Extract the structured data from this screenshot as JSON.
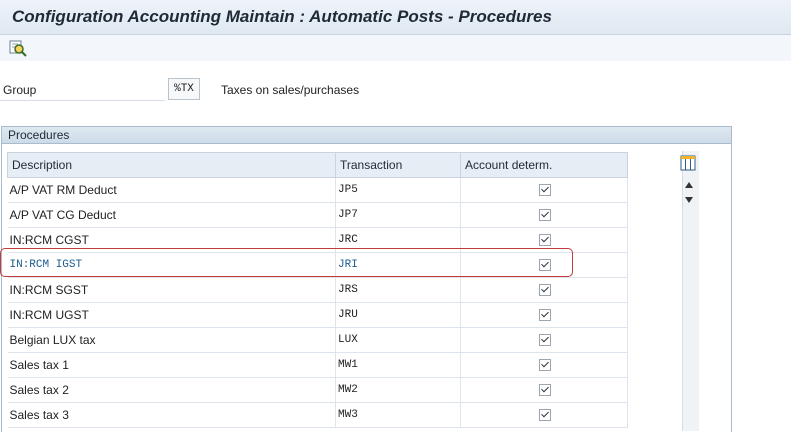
{
  "title": "Configuration Accounting Maintain : Automatic Posts - Procedures",
  "toolbar": {
    "icon": "find-icon"
  },
  "group": {
    "label": "Group",
    "value": "%TX",
    "description": "Taxes on sales/purchases"
  },
  "procedures": {
    "title": "Procedures",
    "columns": [
      "Description",
      "Transaction",
      "Account determ."
    ],
    "rows": [
      {
        "description": "A/P VAT RM Deduct",
        "transaction": "JP5",
        "account_determ": true
      },
      {
        "description": "A/P VAT CG Deduct",
        "transaction": "JP7",
        "account_determ": true
      },
      {
        "description": "IN:RCM CGST",
        "transaction": "JRC",
        "account_determ": true
      },
      {
        "description": "IN:RCM IGST",
        "transaction": "JRI",
        "account_determ": true
      },
      {
        "description": "IN:RCM SGST",
        "transaction": "JRS",
        "account_determ": true
      },
      {
        "description": "IN:RCM UGST",
        "transaction": "JRU",
        "account_determ": true
      },
      {
        "description": "Belgian LUX tax",
        "transaction": "LUX",
        "account_determ": true
      },
      {
        "description": "Sales tax 1",
        "transaction": "MW1",
        "account_determ": true
      },
      {
        "description": "Sales tax 2",
        "transaction": "MW2",
        "account_determ": true
      },
      {
        "description": "Sales tax 3",
        "transaction": "MW3",
        "account_determ": true
      }
    ]
  },
  "colors": {
    "highlight": "#c23b3b",
    "selected_text": "#1b5c93"
  }
}
